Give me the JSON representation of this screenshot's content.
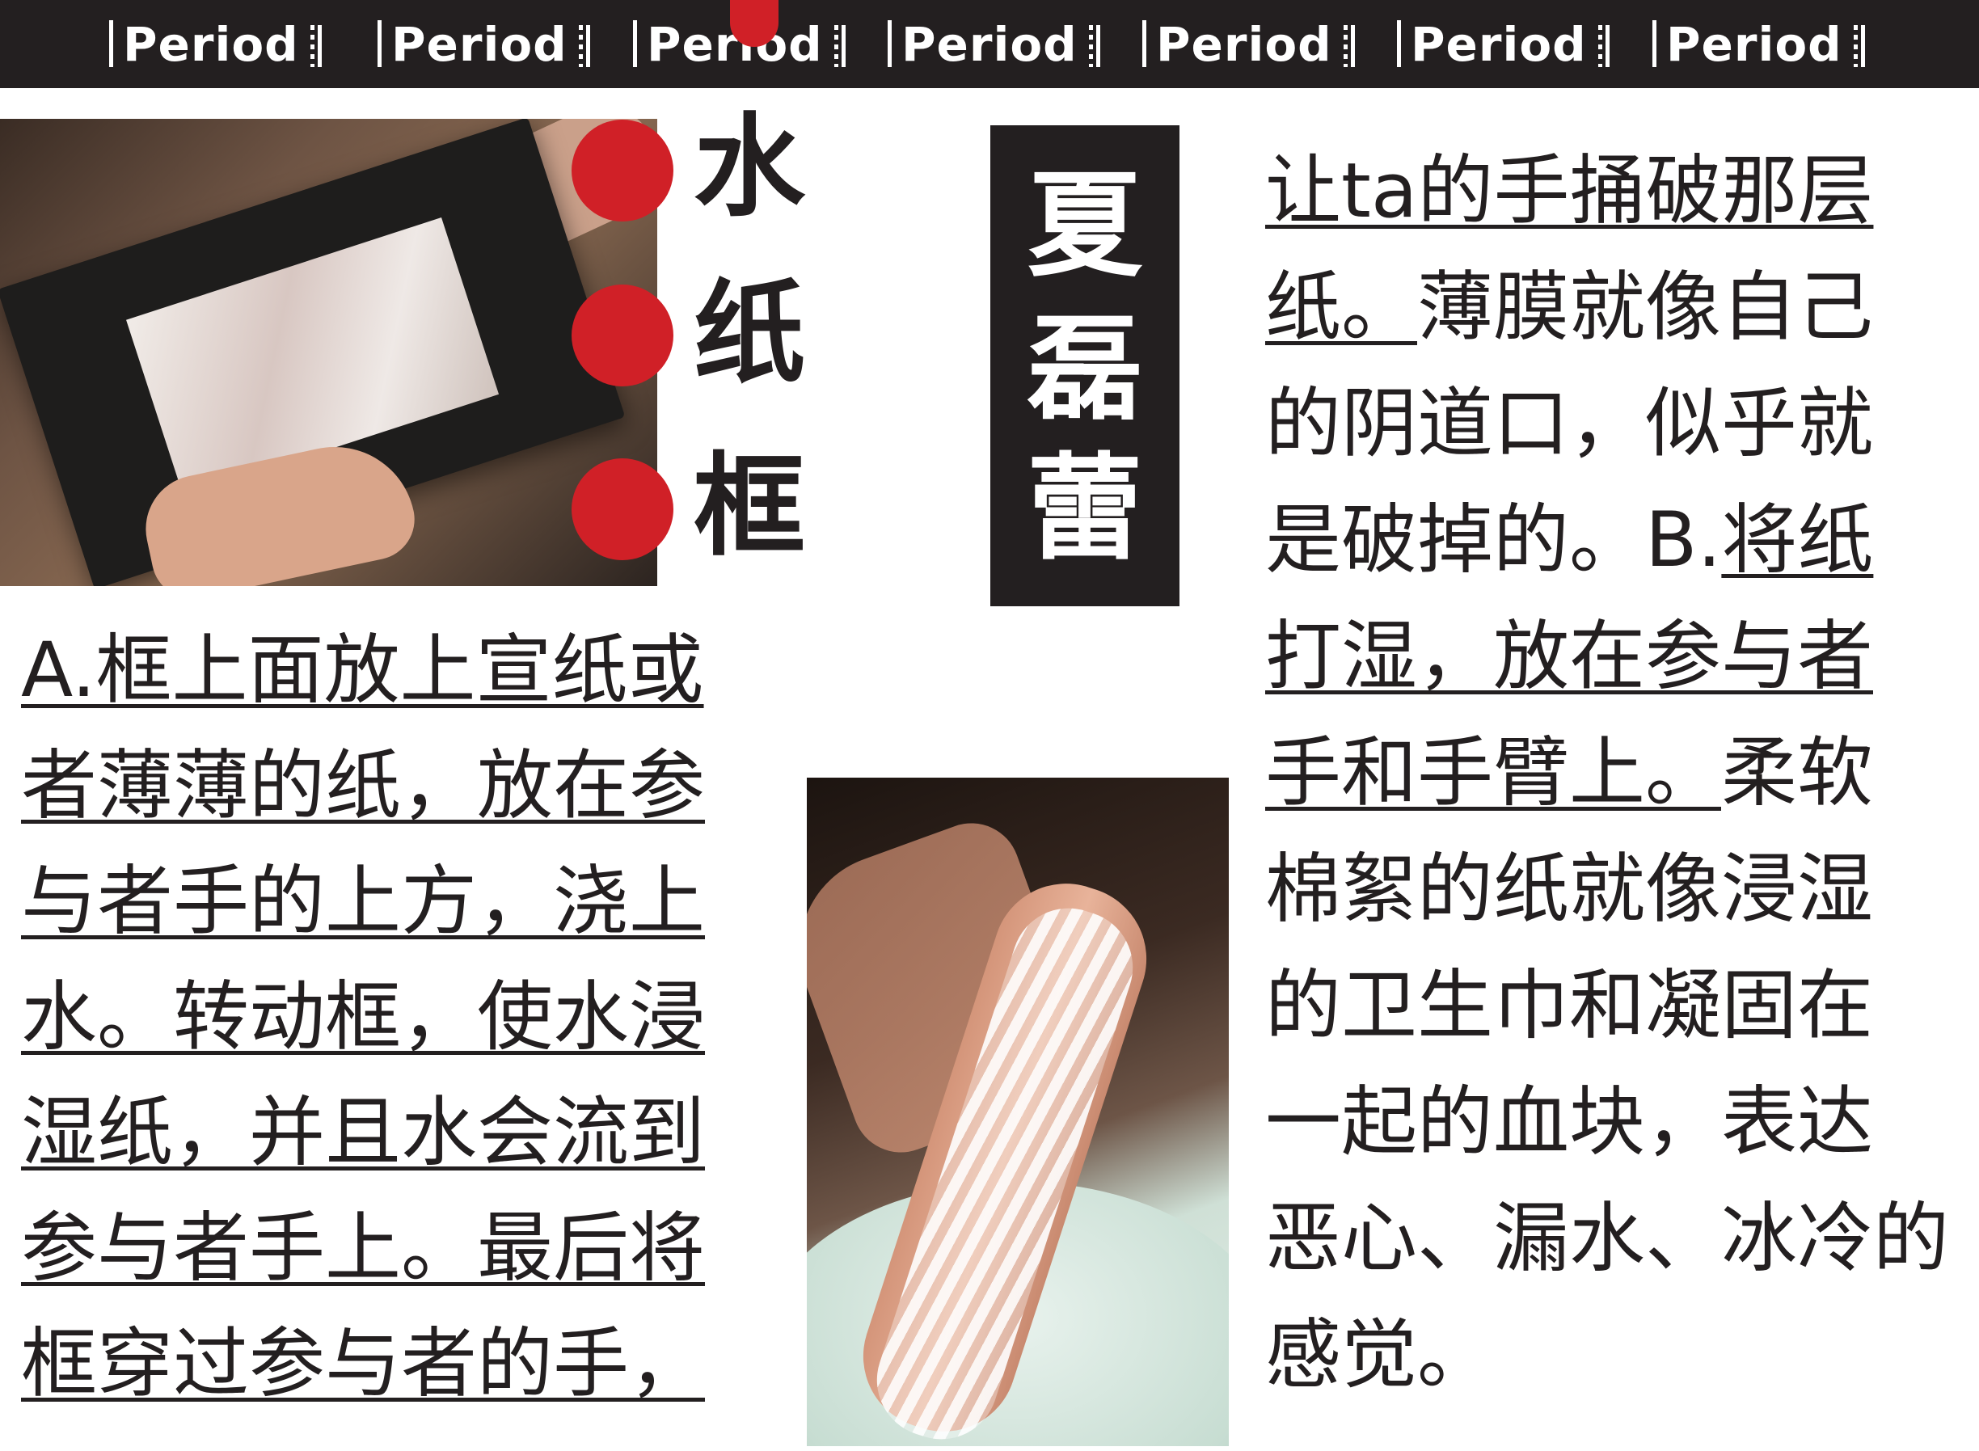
{
  "header": {
    "tabs": [
      "Period",
      "Period",
      "Period",
      "Period",
      "Period",
      "Period",
      "Period"
    ],
    "accent_color": "#d02027",
    "bar_color": "#231f20"
  },
  "title_vertical": [
    "水",
    "纸",
    "框"
  ],
  "author_vertical": [
    "夏",
    "磊",
    "蕾"
  ],
  "text_a": [
    "A.框上面放上宣纸或",
    "者薄薄的纸，放在参",
    "与者手的上方，浇上",
    "水。转动框，使水浸",
    "湿纸，并且水会流到",
    "参与者手上。最后将",
    "框穿过参与者的手，"
  ],
  "text_right": {
    "line1": "让ta的手捅破那层",
    "line2_u": "纸。",
    "line2_rest": "薄膜就像自己",
    "line3": "的阴道口，似乎就",
    "line4_plain": "是破掉的。B.",
    "line4_u": "将纸",
    "line5": "打湿，放在参与者",
    "line6_u": "手和手臂上。",
    "line6_rest": "柔软",
    "line7": "棉絮的纸就像浸湿",
    "line8": "的卫生巾和凝固在",
    "line9": "一起的血块，表达",
    "line10": "恶心、漏水、冰冷的",
    "line11": "感觉。"
  },
  "images": {
    "photo1": "hands-holding-black-frame-with-wet-paper",
    "photo2": "arm-covered-in-wet-paper-over-bowl"
  }
}
